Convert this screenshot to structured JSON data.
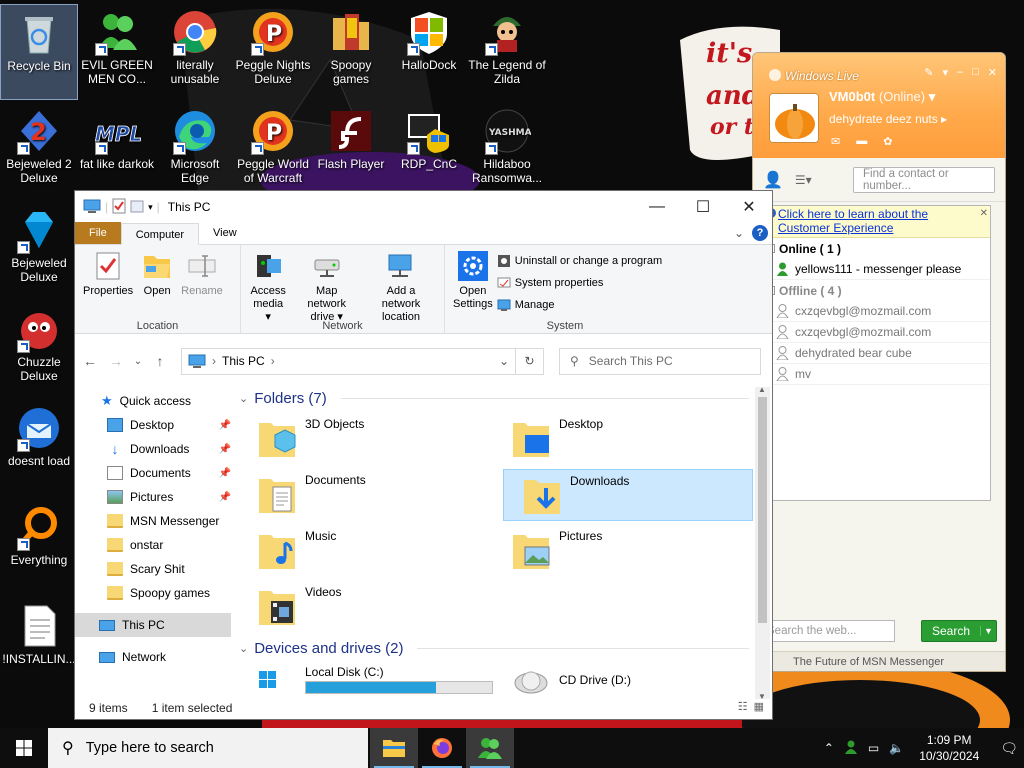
{
  "desktop": {
    "icons": [
      {
        "label": "Recycle Bin",
        "icon": "recycle-bin-icon"
      },
      {
        "label": "EVIL GREEN MEN CO...",
        "icon": "msn-people-icon"
      },
      {
        "label": "literally unusable",
        "icon": "chrome-icon"
      },
      {
        "label": "Peggle Nights Deluxe",
        "icon": "peggle-icon"
      },
      {
        "label": "Spoopy games",
        "icon": "folder-icon"
      },
      {
        "label": "HalloDock",
        "icon": "windows-shield-icon"
      },
      {
        "label": "The Legend of Zilda",
        "icon": "game-character-icon"
      },
      {
        "label": "Bejeweled 2 Deluxe",
        "icon": "bejeweled2-icon"
      },
      {
        "label": "fat like darkok",
        "icon": "mpl-icon"
      },
      {
        "label": "Microsoft Edge",
        "icon": "edge-icon"
      },
      {
        "label": "Peggle World of Warcraft",
        "icon": "peggle-icon"
      },
      {
        "label": "Flash Player",
        "icon": "flash-icon"
      },
      {
        "label": "RDP_CnC",
        "icon": "rdp-icon"
      },
      {
        "label": "Hildaboo Ransomwa...",
        "icon": "yashma-icon"
      },
      {
        "label": "Bejeweled Deluxe",
        "icon": "gem-icon"
      },
      {
        "label": "Chuzzle Deluxe",
        "icon": "chuzzle-icon"
      },
      {
        "label": "doesnt load",
        "icon": "thunderbird-icon"
      },
      {
        "label": "Everything",
        "icon": "everything-icon"
      },
      {
        "label": "!INSTALLIN...",
        "icon": "text-file-icon"
      }
    ],
    "wallpaper_text": "it's time to get shit and or t"
  },
  "explorer": {
    "title": "This PC",
    "window_controls": {
      "minimize": "—",
      "maximize": "☐",
      "close": "✕"
    },
    "tabs": {
      "file": "File",
      "computer": "Computer",
      "view": "View"
    },
    "ribbon": {
      "location": {
        "label": "Location",
        "buttons": [
          "Properties",
          "Open",
          "Rename"
        ]
      },
      "network": {
        "label": "Network",
        "buttons": [
          {
            "line1": "Access",
            "line2": "media ▾"
          },
          {
            "line1": "Map network",
            "line2": "drive ▾"
          },
          {
            "line1": "Add a network",
            "line2": "location"
          }
        ]
      },
      "system": {
        "label": "System",
        "open_settings": {
          "line1": "Open",
          "line2": "Settings"
        },
        "items": [
          "Uninstall or change a program",
          "System properties",
          "Manage"
        ]
      }
    },
    "address": {
      "path": "This PC",
      "separator": "›",
      "search_placeholder": "Search This PC"
    },
    "nav_pane": {
      "quick_access": "Quick access",
      "items": [
        {
          "label": "Desktop",
          "pinned": true,
          "icon": "desktop-icon"
        },
        {
          "label": "Downloads",
          "pinned": true,
          "icon": "downloads-icon"
        },
        {
          "label": "Documents",
          "pinned": true,
          "icon": "documents-icon"
        },
        {
          "label": "Pictures",
          "pinned": true,
          "icon": "pictures-icon"
        },
        {
          "label": "MSN Messenger",
          "pinned": false,
          "icon": "folder-icon"
        },
        {
          "label": "onstar",
          "pinned": false,
          "icon": "folder-icon"
        },
        {
          "label": "Scary Shit",
          "pinned": false,
          "icon": "folder-icon"
        },
        {
          "label": "Spoopy games",
          "pinned": false,
          "icon": "folder-icon"
        }
      ],
      "this_pc": "This PC",
      "network": "Network"
    },
    "folders_header": "Folders (7)",
    "folders": [
      {
        "label": "3D Objects",
        "icon": "3d-objects-folder-icon"
      },
      {
        "label": "Desktop",
        "icon": "desktop-folder-icon"
      },
      {
        "label": "Documents",
        "icon": "documents-folder-icon"
      },
      {
        "label": "Downloads",
        "icon": "downloads-folder-icon",
        "selected": true
      },
      {
        "label": "Music",
        "icon": "music-folder-icon"
      },
      {
        "label": "Pictures",
        "icon": "pictures-folder-icon"
      },
      {
        "label": "Videos",
        "icon": "videos-folder-icon"
      }
    ],
    "drives_header": "Devices and drives (2)",
    "drives": [
      {
        "label": "Local Disk (C:)",
        "used_fraction": 0.7
      },
      {
        "label": "CD Drive (D:)"
      }
    ],
    "status": {
      "items": "9 items",
      "selected": "1 item selected"
    }
  },
  "msn": {
    "brand": "Windows Live",
    "display_name": "VM0b0t",
    "status": "(Online)",
    "personal_message": "dehydrate deez nuts",
    "search_placeholder": "Find a contact or number...",
    "banner": {
      "line1": "Click here to learn about the",
      "line2": "Customer Experience"
    },
    "online_header": "Online ( 1 )",
    "online": [
      "yellows111 - messenger please"
    ],
    "offline_header": "Offline ( 4 )",
    "offline": [
      "cxzqevbgl@mozmail.com",
      "cxzqevbgl@mozmail.com",
      "dehydrated bear cube",
      "mv"
    ],
    "web_placeholder": "Search the web...",
    "search_button": "Search",
    "footer": "The Future of MSN Messenger"
  },
  "taskbar": {
    "search_placeholder": "Type here to search",
    "time": "1:09 PM",
    "date": "10/30/2024"
  },
  "colors": {
    "msn_orange": "#ffa94a",
    "file_tab": "#b77a1f",
    "selection": "#cce8ff",
    "taskbar": "#0e0e0e"
  }
}
